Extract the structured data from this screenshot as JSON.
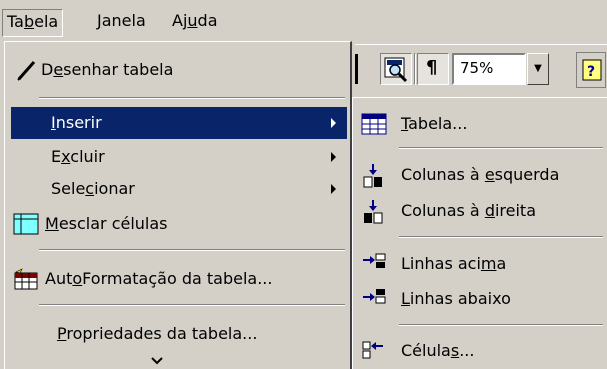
{
  "menubar": {
    "items": [
      {
        "pre": "Ta",
        "key": "b",
        "post": "ela"
      },
      {
        "pre": "",
        "key": "J",
        "post": "anela"
      },
      {
        "pre": "Aj",
        "key": "u",
        "post": "da"
      }
    ]
  },
  "toolbar": {
    "zoom_value": "75%"
  },
  "menu": {
    "draw_table": {
      "pre": "D",
      "key": "e",
      "post": "senhar tabela"
    },
    "insert": {
      "pre": "",
      "key": "I",
      "post": "nserir"
    },
    "delete": {
      "pre": "E",
      "key": "x",
      "post": "cluir"
    },
    "select": {
      "pre": "Sele",
      "key": "c",
      "post": "ionar"
    },
    "merge": {
      "pre": "",
      "key": "M",
      "post": "esclar células"
    },
    "autoformat": {
      "pre": "Aut",
      "key": "o",
      "post": "Formatação da tabela..."
    },
    "properties": {
      "pre": "",
      "key": "P",
      "post": "ropriedades da tabela..."
    }
  },
  "submenu": {
    "table": {
      "pre": "",
      "key": "T",
      "post": "abela..."
    },
    "cols_left": {
      "pre": "Colunas à ",
      "key": "e",
      "post": "squerda"
    },
    "cols_right": {
      "pre": "Colunas à ",
      "key": "d",
      "post": "ireita"
    },
    "rows_above": {
      "pre": "Linhas aci",
      "key": "m",
      "post": "a"
    },
    "rows_below": {
      "pre": "",
      "key": "L",
      "post": "inhas abaixo"
    },
    "cells": {
      "pre": "Célula",
      "key": "s",
      "post": "..."
    }
  },
  "colors": {
    "highlight": "#0a246a",
    "face": "#d4d0c8"
  }
}
